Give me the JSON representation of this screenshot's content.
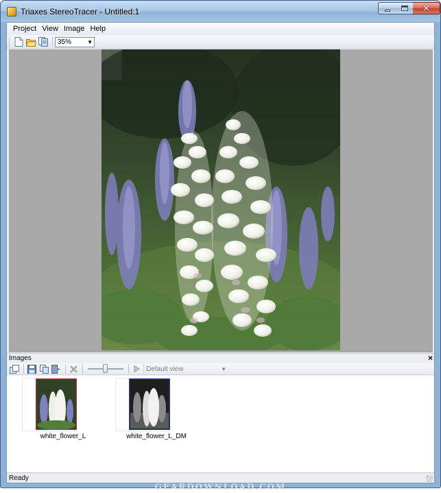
{
  "window": {
    "title": "Triaxes StereoTracer - Untitled:1",
    "icon": "app-icon",
    "controls": [
      "minimize-icon",
      "maximize-icon",
      "close-icon"
    ]
  },
  "menu": {
    "items": [
      {
        "label": "Project",
        "key": "P"
      },
      {
        "label": "View",
        "key": "V"
      },
      {
        "label": "Image",
        "key": "I"
      },
      {
        "label": "Help",
        "key": "H"
      }
    ]
  },
  "toolbar": {
    "buttons": [
      "new-file-icon",
      "open-folder-icon",
      "save-icon"
    ],
    "zoom": "35%"
  },
  "images_panel": {
    "title": "Images",
    "close_glyph": "×",
    "toolbar_buttons": [
      "image-list-icon",
      "save-icon",
      "copy-icon",
      "export-icon",
      "delete-icon",
      "slider",
      "play-icon"
    ],
    "view_select": "Default view",
    "thumbnails": [
      {
        "label": "white_flower_L",
        "border_color": "#b03030",
        "kind": "color"
      },
      {
        "label": "white_flower_L_DM",
        "border_color": "#2f3f9a",
        "kind": "depthmap"
      }
    ]
  },
  "status": {
    "text": "Ready"
  },
  "watermark": "GEARDOWNLOAD.COM"
}
